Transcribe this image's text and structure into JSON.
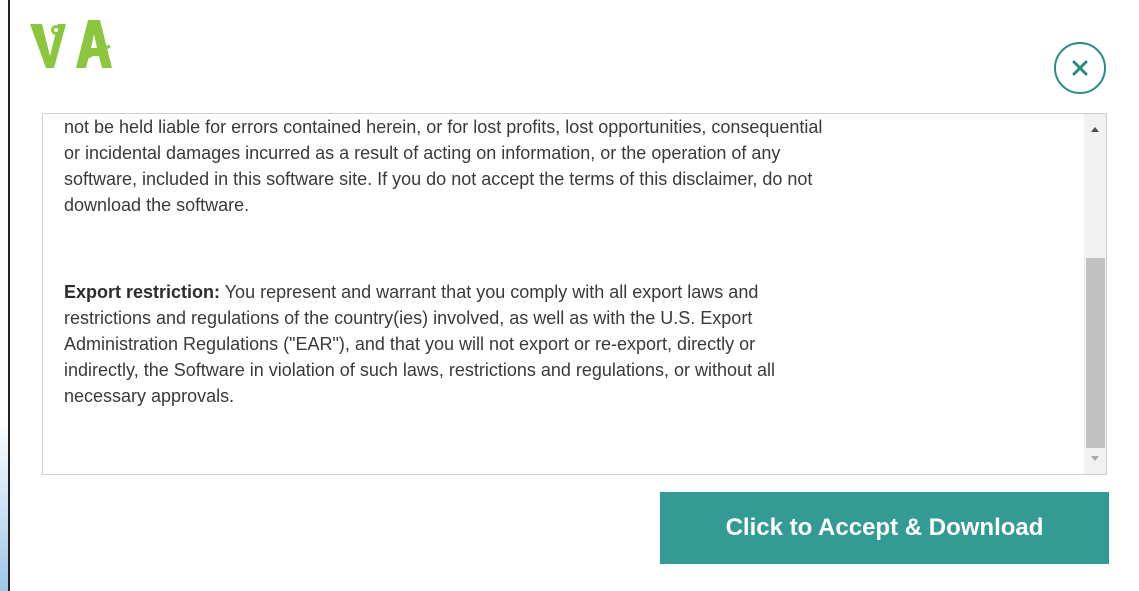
{
  "brand": {
    "logo_text": "VA",
    "logo_color": "#8cc63f"
  },
  "modal": {
    "close_symbol": "×",
    "accent_color": "#2a8c84"
  },
  "terms": {
    "disclaimer_lines": [
      "not be held liable for errors contained herein, or for lost profits, lost opportunities, consequential",
      "or incidental damages incurred as a result of acting on information, or the operation of any",
      "software, included in this software site. If you do not accept the terms of this disclaimer, do not",
      "download the software."
    ],
    "export_label": "Export restriction:",
    "export_lines": [
      " You represent and warrant that you comply with all export laws and",
      "restrictions and regulations of the country(ies) involved, as well as with the U.S. Export",
      "Administration Regulations (\"EAR\"), and that you will not export or re-export, directly or",
      "indirectly, the Software in violation of such laws, restrictions and regulations, or without all",
      "necessary approvals."
    ]
  },
  "actions": {
    "accept_label": "Click to Accept & Download",
    "accept_color": "#339b94"
  },
  "icons": {
    "close": "close-icon",
    "scroll_up": "scroll-up-arrow-icon",
    "scroll_down": "scroll-down-arrow-icon"
  }
}
